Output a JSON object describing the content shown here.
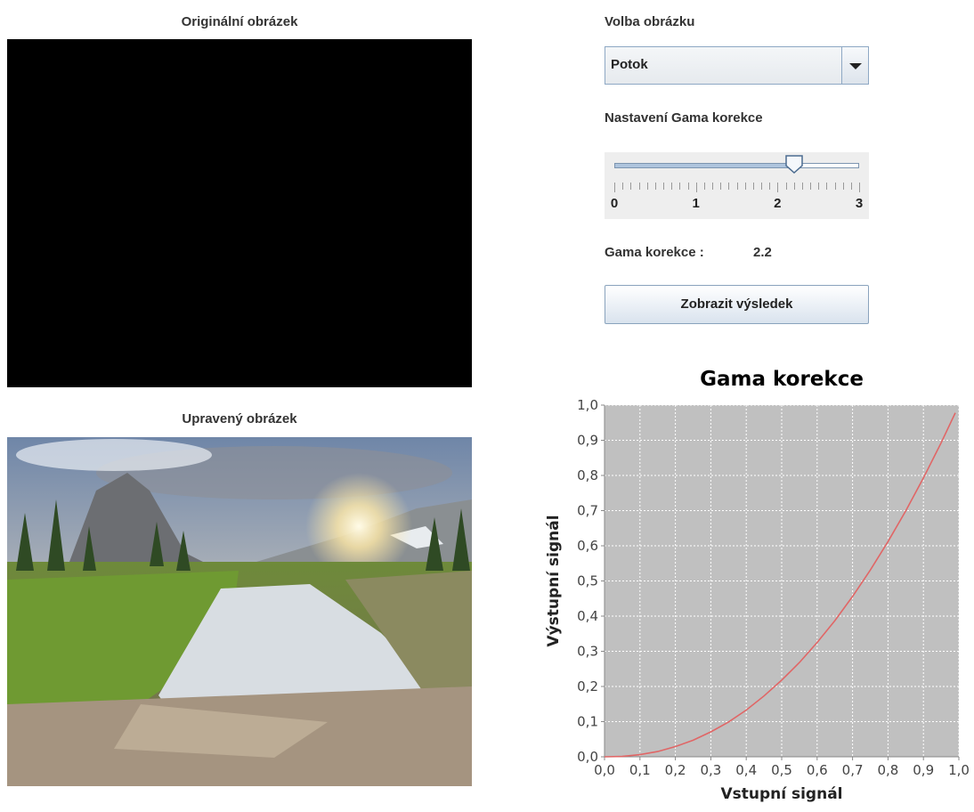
{
  "original": {
    "label": "Originální obrázek"
  },
  "result": {
    "label": "Upravený obrázek"
  },
  "image_select": {
    "label": "Volba obrázku",
    "value": "Potok"
  },
  "gamma_slider": {
    "label": "Nastavení Gama korekce",
    "min": 0,
    "max": 3,
    "value": 2.2,
    "tick_labels": [
      "0",
      "1",
      "2",
      "3"
    ]
  },
  "gamma_value": {
    "label": "Gama korekce :",
    "value": "2.2"
  },
  "show_button": {
    "label": "Zobrazit výsledek"
  },
  "colors": {
    "curve": "#e06666",
    "plot_bg": "#c0c0c0",
    "button_top": "#ffffff",
    "button_bottom": "#d9e3ee"
  },
  "chart_data": {
    "type": "line",
    "title": "Gama korekce",
    "xlabel": "Vstupní signál",
    "ylabel": "Výstupní signál",
    "xlim": [
      0,
      1.0
    ],
    "ylim": [
      0,
      1.0
    ],
    "grid": true,
    "x_ticks": [
      "0,0",
      "0,1",
      "0,2",
      "0,3",
      "0,4",
      "0,5",
      "0,6",
      "0,7",
      "0,8",
      "0,9",
      "1,0"
    ],
    "y_ticks": [
      "0,0",
      "0,1",
      "0,2",
      "0,3",
      "0,4",
      "0,5",
      "0,6",
      "0,7",
      "0,8",
      "0,9",
      "1,0"
    ],
    "series": [
      {
        "x": [
          0.0,
          0.05,
          0.1,
          0.15,
          0.2,
          0.25,
          0.3,
          0.35,
          0.4,
          0.45,
          0.5,
          0.55,
          0.6,
          0.65,
          0.7,
          0.75,
          0.8,
          0.85,
          0.9,
          0.95,
          0.99
        ],
        "y": [
          0.0,
          0.001,
          0.006,
          0.015,
          0.029,
          0.047,
          0.071,
          0.099,
          0.133,
          0.173,
          0.218,
          0.268,
          0.325,
          0.387,
          0.456,
          0.531,
          0.612,
          0.699,
          0.793,
          0.893,
          0.978
        ]
      }
    ]
  }
}
